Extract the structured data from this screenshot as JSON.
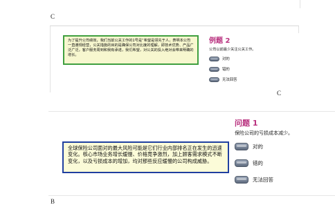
{
  "corners": {
    "top_left": "C",
    "mid_right": "C",
    "bottom_left": "B"
  },
  "slide1": {
    "text": "为了提升公司绩效，我们当前公关工作的1号是“希望是领先于人，表明本公司一直遵规经营，公关措施的目的是确保公司对比度的理解，即技术优势、产品广泛广泛，客户服务周到和我有承诺，我们希望，对公关的投入绝对会带来明确的增长。",
    "title": "例题 2",
    "question": "公司以前最少关注公关工作。",
    "options": [
      "对的",
      "错的",
      "无法回答"
    ]
  },
  "slide2": {
    "small_label": "",
    "text": "全球保险公司面对的最大风险可能是它们行业内部排名正在发生的迅速变化。核心市场业务增长缓慢、价格竞争激烈，加上顾客需求模式不断变化，以及亏损成本的增加，均对那些反应缓慢的公司构成威胁。",
    "title": "问题 1",
    "question": "保险公司的亏损成本减少。",
    "options": [
      "对的",
      "错的",
      "无法回答"
    ]
  }
}
